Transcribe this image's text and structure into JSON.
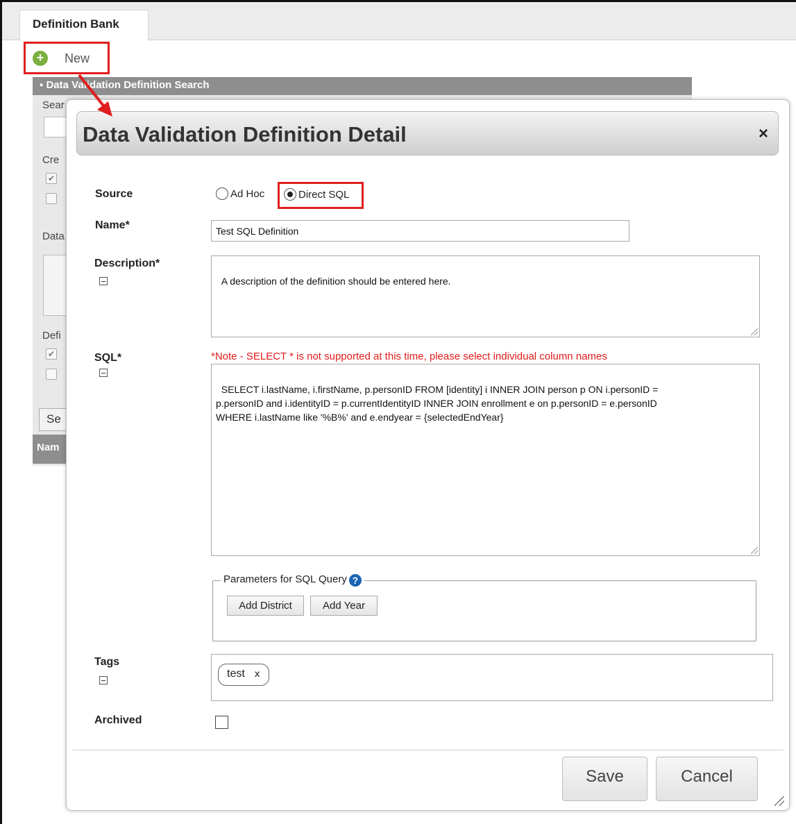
{
  "tabs": {
    "definition_bank": "Definition Bank"
  },
  "toolbar": {
    "new_label": "New"
  },
  "background_panel": {
    "header": "Data Validation Definition Search",
    "search_label": "Sear",
    "created_label": "Cre",
    "data_label": "Data",
    "definition_label": "Defi",
    "search_button": "Se",
    "name_column": "Nam"
  },
  "modal": {
    "title": "Data Validation Definition Detail",
    "close": "×",
    "source": {
      "label": "Source",
      "options": [
        "Ad Hoc",
        "Direct SQL"
      ],
      "selected": "Direct SQL"
    },
    "name": {
      "label": "Name*",
      "value": "Test SQL Definition"
    },
    "description": {
      "label": "Description*",
      "value": "A description of the definition should be entered here."
    },
    "sql": {
      "label": "SQL*",
      "note": "*Note - SELECT * is not supported at this time, please select individual column names",
      "value": "SELECT i.lastName, i.firstName, p.personID FROM [identity] i INNER JOIN person p ON i.personID =\np.personID and i.identityID = p.currentIdentityID INNER JOIN enrollment e on p.personID = e.personID\nWHERE i.lastName like '%B%' and e.endyear = {selectedEndYear}"
    },
    "parameters": {
      "legend": "Parameters for SQL Query",
      "help_icon": "?",
      "buttons": [
        "Add District",
        "Add Year"
      ]
    },
    "tags": {
      "label": "Tags",
      "items": [
        "test"
      ],
      "remove_glyph": "x"
    },
    "archived": {
      "label": "Archived",
      "checked": false
    },
    "actions": {
      "save": "Save",
      "cancel": "Cancel"
    }
  },
  "colors": {
    "highlight": "#e01e1e",
    "note": "#e31b1b",
    "help": "#1a64b3",
    "plus": "#7ab03f"
  }
}
